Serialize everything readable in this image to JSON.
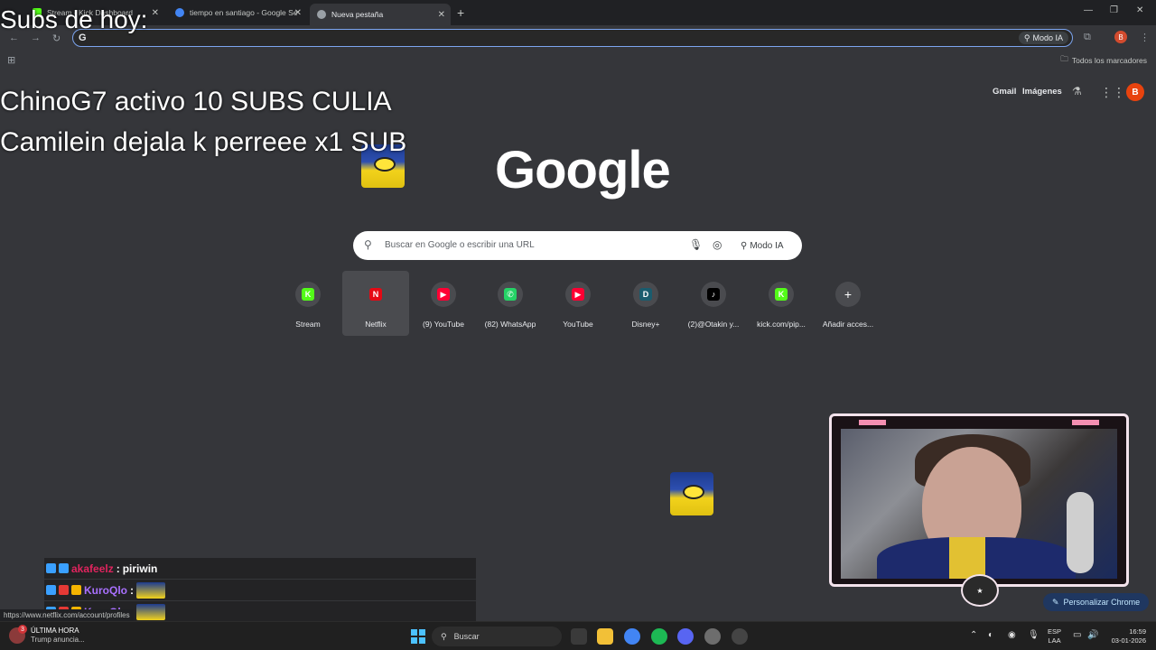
{
  "tabs": [
    {
      "label": "Stream - Kick Dashboard",
      "color": "#53fc18"
    },
    {
      "label": "tiempo en santiago - Google Se",
      "color": "#4285f4"
    },
    {
      "label": "Nueva pestaña",
      "color": "#9aa0a6"
    }
  ],
  "omnibox": {
    "modo_ia": "Modo IA"
  },
  "bookmarks": {
    "all": "Todos los marcadores"
  },
  "overlay": {
    "subs_title": "Subs de hoy:",
    "line1": "ChinoG7 activo 10 SUBS CULIA",
    "line2": "Camilein dejala k perreee x1 SUB"
  },
  "google": {
    "gmail": "Gmail",
    "images": "Imágenes",
    "avatar": "B",
    "logo": "Google",
    "search_placeholder": "Buscar en Google o escribir una URL",
    "modo_ia": "Modo IA"
  },
  "shortcuts": [
    {
      "label": "Stream",
      "glyph": "K",
      "bg": "#53fc18"
    },
    {
      "label": "Netflix",
      "glyph": "N",
      "bg": "#e50914"
    },
    {
      "label": "(9) YouTube",
      "glyph": "▶",
      "bg": "#ff0033"
    },
    {
      "label": "(82) WhatsApp",
      "glyph": "✆",
      "bg": "#25d366"
    },
    {
      "label": "YouTube",
      "glyph": "▶",
      "bg": "#ff0033"
    },
    {
      "label": "Disney+",
      "glyph": "D",
      "bg": "#1a5c6e"
    },
    {
      "label": "(2)@Otakin y...",
      "glyph": "♪",
      "bg": "#000000"
    },
    {
      "label": "kick.com/pip...",
      "glyph": "K",
      "bg": "#53fc18"
    },
    {
      "label": "Añadir acces...",
      "glyph": "+",
      "bg": "transparent"
    }
  ],
  "customize_chrome": "Personalizar Chrome",
  "chat": [
    {
      "user": "akafeelz",
      "user_color": "#e0245e",
      "sep": " :",
      "msg": " piriwin",
      "emote": false
    },
    {
      "user": "KuroQlo",
      "user_color": "#a970ff",
      "sep": " :",
      "msg": "",
      "emote": true
    },
    {
      "user": "KuroQlo",
      "user_color": "#a970ff",
      "sep": " :",
      "msg": "",
      "emote": true
    }
  ],
  "status_url": "https://www.netflix.com/account/profiles",
  "taskbar": {
    "news_title": "ÚLTIMA HORA",
    "news_sub": "Trump anuncia...",
    "news_badge": "3",
    "search": "Buscar",
    "lang1": "ESP",
    "lang2": "LAA",
    "time": "16:59",
    "date": "03-01-2026"
  }
}
